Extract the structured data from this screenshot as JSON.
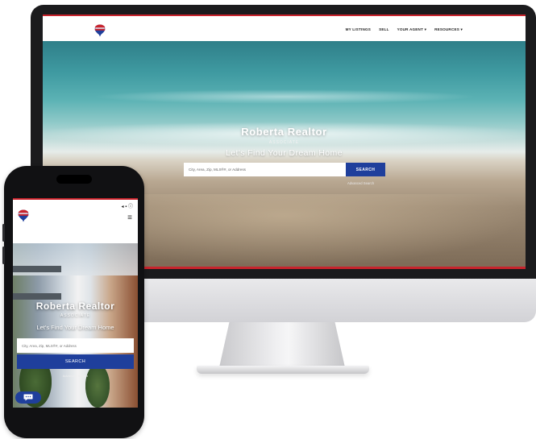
{
  "desktop": {
    "nav": [
      "MY LISTINGS",
      "SELL",
      "YOUR AGENT",
      "RESOURCES"
    ],
    "nav_dropdown_marker": "▾",
    "hero": {
      "title": "Roberta Realtor",
      "subtitle": "ASSOCIATE",
      "tagline": "Let's Find Your Dream Home",
      "search_placeholder": "City, Area, Zip, MLS®#, or Address",
      "search_button": "SEARCH",
      "advanced_link": "Advanced Search"
    }
  },
  "mobile": {
    "status_icons": "◂ ▪ ⓘ",
    "menu_icon": "≡",
    "hero": {
      "title": "Roberta Realtor",
      "subtitle": "ASSOCIATE",
      "tagline": "Let's Find Your Dream Home",
      "search_placeholder": "City, Area, Zip, MLS®#, or Address",
      "search_button": "SEARCH",
      "advanced_link": "Advanced Search"
    },
    "chat_icon": "chat-bubble-icon"
  },
  "colors": {
    "brand_red": "#c8232c",
    "brand_blue": "#1f3f9c"
  }
}
